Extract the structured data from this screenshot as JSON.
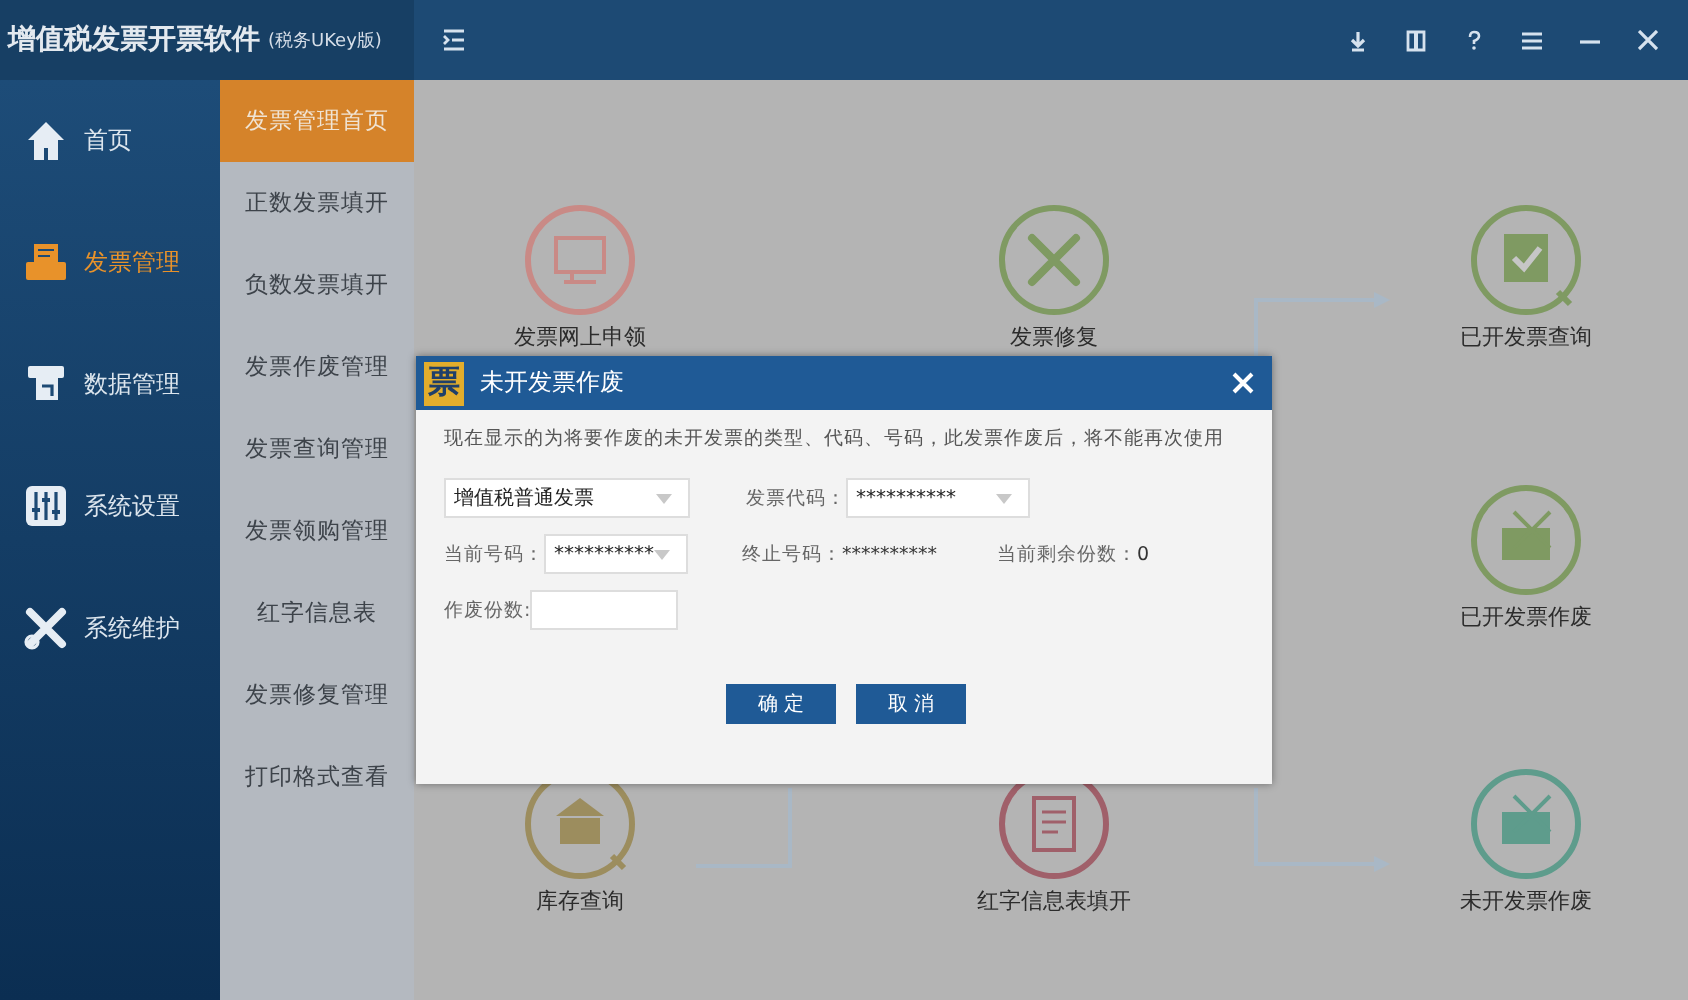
{
  "window": {
    "title": "增值税发票开票软件",
    "subtitle": "(税务UKey版)"
  },
  "nav": [
    {
      "label": "首页",
      "selected": false
    },
    {
      "label": "发票管理",
      "selected": true
    },
    {
      "label": "数据管理",
      "selected": false
    },
    {
      "label": "系统设置",
      "selected": false
    },
    {
      "label": "系统维护",
      "selected": false
    }
  ],
  "submenu": [
    {
      "label": "发票管理首页",
      "selected": true
    },
    {
      "label": "正数发票填开",
      "selected": false
    },
    {
      "label": "负数发票填开",
      "selected": false
    },
    {
      "label": "发票作废管理",
      "selected": false
    },
    {
      "label": "发票查询管理",
      "selected": false
    },
    {
      "label": "发票领购管理",
      "selected": false
    },
    {
      "label": "红字信息表",
      "selected": false
    },
    {
      "label": "发票修复管理",
      "selected": false
    },
    {
      "label": "打印格式查看",
      "selected": false
    }
  ],
  "flow_nodes": [
    {
      "label": "发票网上申领",
      "color": "#c98a86"
    },
    {
      "label": "发票修复",
      "color": "#7f9a62"
    },
    {
      "label": "已开发票查询",
      "color": "#7f9a62"
    },
    {
      "label": "已开发票作废",
      "color": "#7f9a62"
    },
    {
      "label": "库存查询",
      "color": "#9c8d5e"
    },
    {
      "label": "红字信息表填开",
      "color": "#a0606a"
    },
    {
      "label": "未开发票作废",
      "color": "#5e9c8c"
    }
  ],
  "dialog": {
    "icon_text": "票",
    "title": "未开发票作废",
    "message": "现在显示的为将要作废的未开发票的类型、代码、号码，此发票作废后，将不能再次使用",
    "invoice_type": "增值税普通发票",
    "invoice_code_label": "发票代码：",
    "invoice_code": "**********",
    "current_number_label": "当前号码：",
    "current_number": "**********",
    "end_number_label": "终止号码：",
    "end_number": "**********",
    "remaining_label": "当前剩余份数：",
    "remaining": "0",
    "void_count_label": "作废份数:",
    "buttons": [
      "确 定",
      "取 消"
    ]
  }
}
